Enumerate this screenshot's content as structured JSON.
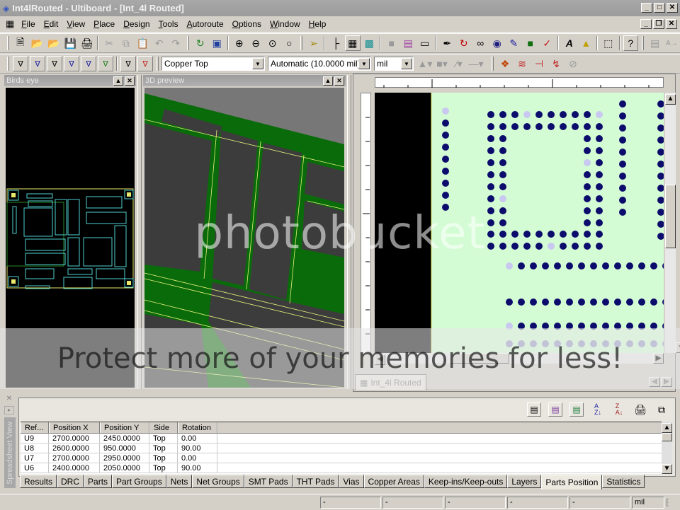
{
  "window": {
    "title": "Int4lRouted - Ultiboard - [Int_4l Routed]",
    "controls": [
      "minimize",
      "maximize",
      "close"
    ],
    "mdi_controls": [
      "minimize",
      "restore",
      "close"
    ]
  },
  "menu": {
    "items": [
      {
        "label": "File",
        "key": "F"
      },
      {
        "label": "Edit",
        "key": "E"
      },
      {
        "label": "View",
        "key": "V"
      },
      {
        "label": "Place",
        "key": "P"
      },
      {
        "label": "Design",
        "key": "D"
      },
      {
        "label": "Tools",
        "key": "T"
      },
      {
        "label": "Autoroute",
        "key": "A"
      },
      {
        "label": "Options",
        "key": "O"
      },
      {
        "label": "Window",
        "key": "W"
      },
      {
        "label": "Help",
        "key": "H"
      }
    ]
  },
  "toolbar1": {
    "icons": [
      "new-icon",
      "open-icon",
      "open-project-icon",
      "save-icon",
      "print-icon",
      "cut-icon",
      "copy-icon",
      "paste-icon",
      "undo-icon",
      "redo-icon",
      "refresh-icon",
      "view-3d-icon",
      "zoom-in-icon",
      "zoom-out-icon",
      "zoom-window-icon",
      "zoom-full-icon",
      "select-icon",
      "hierarchy-icon",
      "grid-icon",
      "component-icon",
      "part-wizard-icon",
      "footprint-icon",
      "place-part-icon",
      "draw-line-icon",
      "trace-icon",
      "follow-me-icon",
      "connection-icon",
      "bus-icon",
      "copper-area-icon",
      "ratsnest-icon",
      "text-icon",
      "group-icon",
      "select-box-icon",
      "help-icon",
      "align-icon",
      "rename-icon"
    ]
  },
  "toolbar2": {
    "filter_icons": [
      "filter-parts-icon",
      "filter-traces-icon",
      "filter-copper-icon",
      "filter-vias-icon",
      "filter-smt-icon",
      "filter-tht-icon",
      "filter-attributes-icon",
      "filter-shapes-icon"
    ],
    "layer_select": "Copper Top",
    "width_select": "Automatic (10.0000 mil)",
    "unit_select": "mil",
    "tool_icons": [
      "fill-color-icon",
      "fill-pattern-icon",
      "line-style-icon",
      "line-width-icon",
      "autoroute-icon",
      "fanout-icon",
      "drc-icon",
      "lightning-icon",
      "disabled-icon"
    ]
  },
  "panels": {
    "birds_eye": {
      "title": "Birds eye"
    },
    "preview_3d": {
      "title": "3D preview"
    }
  },
  "layout_view": {
    "doc_tab": "Int_4l Routed"
  },
  "spreadsheet": {
    "side_label": "Spreadsheet View",
    "toolbar_icons": [
      "export-icon",
      "export-csv-icon",
      "export-excel-icon",
      "sort-asc-icon",
      "sort-desc-icon",
      "print-icon",
      "copy-icon"
    ],
    "columns": [
      "Ref...",
      "Position X",
      "Position Y",
      "Side",
      "Rotation"
    ],
    "rows": [
      [
        "U9",
        "2700.0000",
        "2450.0000",
        "Top",
        "0.00"
      ],
      [
        "U8",
        "2600.0000",
        "950.0000",
        "Top",
        "90.00"
      ],
      [
        "U7",
        "2700.0000",
        "2950.0000",
        "Top",
        "0.00"
      ],
      [
        "U6",
        "2400.0000",
        "2050.0000",
        "Top",
        "90.00"
      ]
    ],
    "tabs": [
      "Results",
      "DRC",
      "Parts",
      "Part Groups",
      "Nets",
      "Net Groups",
      "SMT Pads",
      "THT Pads",
      "Vias",
      "Copper Areas",
      "Keep-ins/Keep-outs",
      "Layers",
      "Parts Position",
      "Statistics"
    ],
    "active_tab": "Parts Position"
  },
  "statusbar": {
    "fields": [
      "-",
      "-",
      "-",
      "-",
      "-"
    ],
    "unit": "mil"
  },
  "watermark": {
    "logo": "photobucket",
    "text": "Protect more of your memories for less!"
  },
  "colors": {
    "board_bg": "#d4fcd4",
    "pad": "#0c0c6c",
    "outline": "#48d0d0",
    "copper3d": "#0a6b0a",
    "title_bg": "#a4a4a4"
  }
}
